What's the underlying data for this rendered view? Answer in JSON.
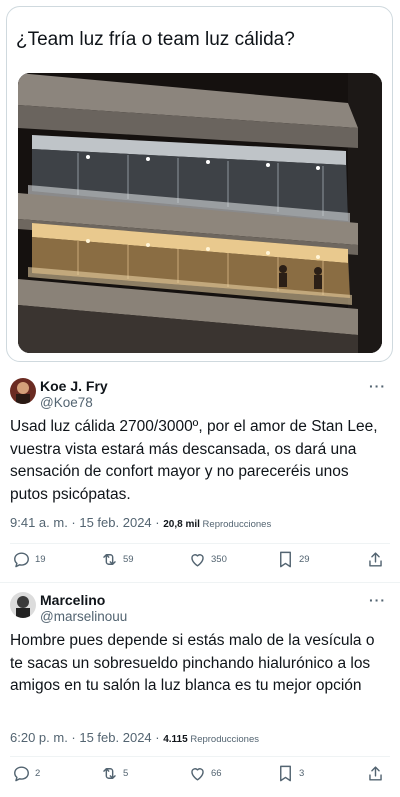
{
  "quoted": {
    "text": "¿Team luz fría o team luz cálida?"
  },
  "tweets": [
    {
      "author_name": "Koe J. Fry",
      "author_handle": "@Koe78",
      "text": "Usad luz cálida 2700/3000º, por el amor de Stan Lee, vuestra vista estará más descansada, os dará una sensación de confort mayor y no pareceréis unos putos psicópatas.",
      "time": "9:41 a. m. · 15 feb. 2024 · ",
      "views_count": "20,8 mil",
      "views_label": " Reproducciones",
      "replies": "19",
      "retweets": "59",
      "likes": "350",
      "bookmarks": "29"
    },
    {
      "author_name": "Marcelino",
      "author_handle": "@marselinouu",
      "text": "Hombre pues depende si estás malo de la vesícula o te sacas un sobresueldo pinchando hialurónico a los amigos en tu salón la luz blanca es tu mejor opción",
      "time": "6:20 p. m. · 15 feb. 2024 · ",
      "views_count": "4.115",
      "views_label": " Reproducciones",
      "replies": "2",
      "retweets": "5",
      "likes": "66",
      "bookmarks": "3"
    }
  ],
  "more_label": "···",
  "colors": {
    "text": "#0f1419",
    "secondary": "#536471",
    "border": "#cfd9de"
  }
}
